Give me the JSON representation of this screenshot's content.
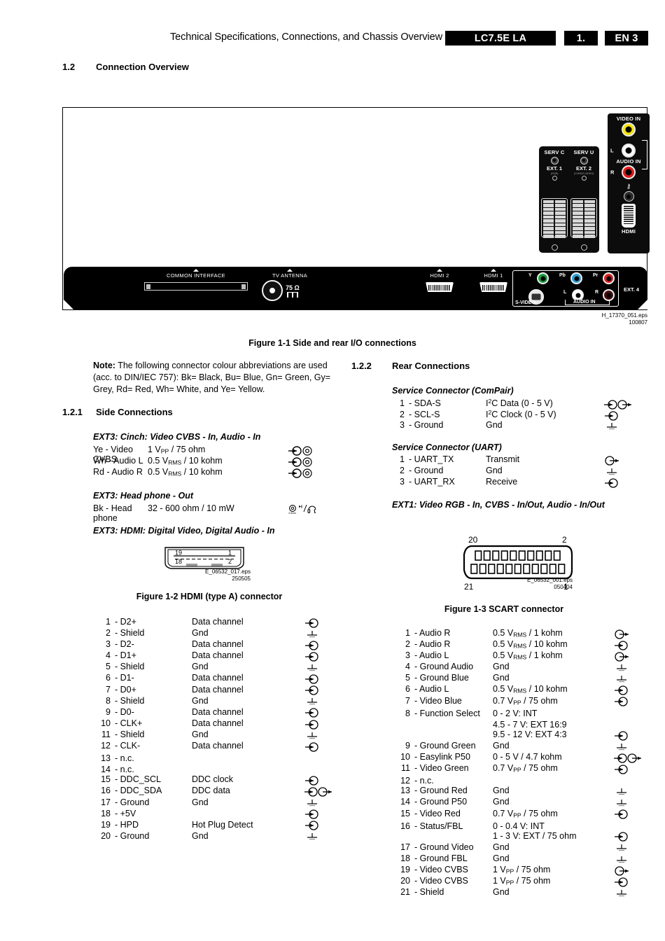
{
  "header": {
    "title": "Technical Specifications, Connections, and Chassis Overview",
    "chassis": "LC7.5E LA",
    "chapter": "1.",
    "page": "EN 3"
  },
  "section": {
    "number": "1.2",
    "title": "Connection Overview"
  },
  "figure1": {
    "caption": "Figure 1-1 Side and rear I/O connections",
    "eps": "H_17370_051.eps",
    "eps_date": "100807",
    "side_panel": {
      "serv_c": "SERV C",
      "serv_u": "SERV U",
      "ext1": "EXT. 1",
      "ext1_sub": "(RGB)",
      "ext2": "EXT. 2",
      "ext2_sub": "(CVBS/S-VIDEO)"
    },
    "right_strip": {
      "video_in": "VIDEO IN",
      "audio_in": "AUDIO IN",
      "left": "L",
      "right": "R",
      "hdmi": "HDMI"
    },
    "bottom": {
      "common_interface": "COMMON INTERFACE",
      "tv_antenna": "TV ANTENNA",
      "ohm": "75 Ω",
      "hdmi2": "HDMI 2",
      "hdmi1": "HDMI 1",
      "ext4": "EXT. 4",
      "y": "Y",
      "pb": "Pb",
      "pr": "Pr",
      "l": "L",
      "r": "R",
      "svideo": "S-VIDEO",
      "audio_in": "AUDIO IN"
    }
  },
  "note": {
    "label": "Note:",
    "text": " The following connector colour abbreviations are used (acc. to DIN/IEC 757): Bk= Black, Bu= Blue, Gn= Green, Gy= Grey, Rd= Red, Wh= White, and Ye= Yellow."
  },
  "side_connections": {
    "number": "1.2.1",
    "title": "Side Connections",
    "cinch": {
      "title": "EXT3: Cinch: Video CVBS - In, Audio - In",
      "rows": [
        {
          "name": "Ye  - Video CVBS",
          "desc": "1 V<sub>PP</sub> / 75 ohm",
          "sym": "in-cinch"
        },
        {
          "name": "Wh - Audio L",
          "desc": "0.5 V<sub>RMS</sub> / 10 kohm",
          "sym": "in-cinch"
        },
        {
          "name": "Rd  - Audio R",
          "desc": "0.5 V<sub>RMS</sub> / 10 kohm",
          "sym": "in-cinch"
        }
      ]
    },
    "headphone": {
      "title": "EXT3: Head phone - Out",
      "rows": [
        {
          "name": "Bk  - Head phone",
          "desc": "32 - 600 ohm / 10 mW",
          "sym": "headphone"
        }
      ]
    },
    "hdmi": {
      "title": "EXT3: HDMI: Digital Video, Digital Audio - In",
      "figure": {
        "caption": "Figure 1-2 HDMI (type A) connector",
        "pin_top_left": "19",
        "pin_top_right": "1",
        "pin_bot_left": "18",
        "pin_bot_right": "2",
        "eps": "E_06532_017.eps",
        "eps_date": "250505"
      },
      "rows": [
        {
          "pin": "1",
          "name": "- D2+",
          "desc": "Data channel",
          "sym": "in"
        },
        {
          "pin": "2",
          "name": "- Shield",
          "desc": "Gnd",
          "sym": "gnd"
        },
        {
          "pin": "3",
          "name": "- D2-",
          "desc": "Data channel",
          "sym": "in"
        },
        {
          "pin": "4",
          "name": "- D1+",
          "desc": "Data channel",
          "sym": "in"
        },
        {
          "pin": "5",
          "name": "- Shield",
          "desc": "Gnd",
          "sym": "gnd"
        },
        {
          "pin": "6",
          "name": "- D1-",
          "desc": "Data channel",
          "sym": "in"
        },
        {
          "pin": "7",
          "name": "- D0+",
          "desc": "Data channel",
          "sym": "in"
        },
        {
          "pin": "8",
          "name": "- Shield",
          "desc": "Gnd",
          "sym": "gnd"
        },
        {
          "pin": "9",
          "name": "- D0-",
          "desc": "Data channel",
          "sym": "in"
        },
        {
          "pin": "10",
          "name": "- CLK+",
          "desc": "Data channel",
          "sym": "in"
        },
        {
          "pin": "11",
          "name": "- Shield",
          "desc": "Gnd",
          "sym": "gnd"
        },
        {
          "pin": "12",
          "name": "- CLK-",
          "desc": "Data channel",
          "sym": "in"
        },
        {
          "pin": "13",
          "name": "- n.c.",
          "desc": "",
          "sym": ""
        },
        {
          "pin": "14",
          "name": "- n.c.",
          "desc": "",
          "sym": ""
        },
        {
          "pin": "15",
          "name": "- DDC_SCL",
          "desc": "DDC clock",
          "sym": "in"
        },
        {
          "pin": "16",
          "name": "- DDC_SDA",
          "desc": "DDC data",
          "sym": "inout"
        },
        {
          "pin": "17",
          "name": "- Ground",
          "desc": "Gnd",
          "sym": "gnd"
        },
        {
          "pin": "18",
          "name": "- +5V",
          "desc": "",
          "sym": "in"
        },
        {
          "pin": "19",
          "name": "- HPD",
          "desc": "Hot Plug Detect",
          "sym": "in"
        },
        {
          "pin": "20",
          "name": "- Ground",
          "desc": "Gnd",
          "sym": "gnd"
        }
      ]
    }
  },
  "rear_connections": {
    "number": "1.2.2",
    "title": "Rear Connections",
    "compair": {
      "title": "Service Connector (ComPair)",
      "rows": [
        {
          "pin": "1",
          "name": "- SDA-S",
          "desc": "I<sup>2</sup>C Data (0 - 5 V)",
          "sym": "inout"
        },
        {
          "pin": "2",
          "name": "- SCL-S",
          "desc": "I<sup>2</sup>C Clock (0 - 5 V)",
          "sym": "in"
        },
        {
          "pin": "3",
          "name": "- Ground",
          "desc": "Gnd",
          "sym": "gnd"
        }
      ]
    },
    "uart": {
      "title": "Service Connector (UART)",
      "rows": [
        {
          "pin": "1",
          "name": "- UART_TX",
          "desc": "Transmit",
          "sym": "out"
        },
        {
          "pin": "2",
          "name": "- Ground",
          "desc": "Gnd",
          "sym": "gnd"
        },
        {
          "pin": "3",
          "name": "- UART_RX",
          "desc": "Receive",
          "sym": "in"
        }
      ]
    },
    "scart": {
      "title": "EXT1: Video RGB - In, CVBS - In/Out, Audio - In/Out",
      "figure": {
        "caption": "Figure 1-3 SCART connector",
        "pin_top_left": "20",
        "pin_top_right": "2",
        "pin_bot_left": "21",
        "pin_bot_right": "1",
        "eps": "E_06532_001.eps",
        "eps_date": "050404"
      },
      "rows": [
        {
          "pin": "1",
          "name": "- Audio R",
          "desc": "0.5 V<sub>RMS</sub> / 1 kohm",
          "sym": "out"
        },
        {
          "pin": "2",
          "name": "- Audio R",
          "desc": "0.5 V<sub>RMS</sub> / 10 kohm",
          "sym": "in"
        },
        {
          "pin": "3",
          "name": "- Audio L",
          "desc": "0.5 V<sub>RMS</sub> / 1 kohm",
          "sym": "out"
        },
        {
          "pin": "4",
          "name": "- Ground Audio",
          "desc": "Gnd",
          "sym": "gnd"
        },
        {
          "pin": "5",
          "name": "- Ground Blue",
          "desc": "Gnd",
          "sym": "gnd"
        },
        {
          "pin": "6",
          "name": "- Audio L",
          "desc": "0.5 V<sub>RMS</sub> / 10 kohm",
          "sym": "in"
        },
        {
          "pin": "7",
          "name": "- Video Blue",
          "desc": "0.7 V<sub>PP</sub> / 75 ohm",
          "sym": "in"
        },
        {
          "pin": "8",
          "name": "- Function Select",
          "desc": "0 - 2 V: INT",
          "sym": ""
        },
        {
          "pin": "",
          "name": "",
          "desc": "4.5 - 7 V: EXT 16:9",
          "sym": ""
        },
        {
          "pin": "",
          "name": "",
          "desc": "9.5 - 12 V: EXT 4:3",
          "sym": "in"
        },
        {
          "pin": "9",
          "name": "- Ground Green",
          "desc": "Gnd",
          "sym": "gnd"
        },
        {
          "pin": "10",
          "name": "- Easylink P50",
          "desc": "0 - 5 V / 4.7 kohm",
          "sym": "inout"
        },
        {
          "pin": "11",
          "name": "- Video Green",
          "desc": "0.7 V<sub>PP</sub> / 75 ohm",
          "sym": "in"
        },
        {
          "pin": "12",
          "name": "- n.c.",
          "desc": "",
          "sym": ""
        },
        {
          "pin": "13",
          "name": "- Ground Red",
          "desc": "Gnd",
          "sym": "gnd"
        },
        {
          "pin": "14",
          "name": "- Ground P50",
          "desc": "Gnd",
          "sym": "gnd"
        },
        {
          "pin": "15",
          "name": "- Video Red",
          "desc": "0.7 V<sub>PP</sub> / 75 ohm",
          "sym": "in"
        },
        {
          "pin": "16",
          "name": "- Status/FBL",
          "desc": "0 - 0.4 V: INT",
          "sym": ""
        },
        {
          "pin": "",
          "name": "",
          "desc": "1 - 3 V: EXT / 75 ohm",
          "sym": "in"
        },
        {
          "pin": "17",
          "name": "- Ground Video",
          "desc": "Gnd",
          "sym": "gnd"
        },
        {
          "pin": "18",
          "name": "- Ground FBL",
          "desc": "Gnd",
          "sym": "gnd"
        },
        {
          "pin": "19",
          "name": "- Video CVBS",
          "desc": "1 V<sub>PP</sub> / 75 ohm",
          "sym": "out"
        },
        {
          "pin": "20",
          "name": "- Video CVBS",
          "desc": "1 V<sub>PP</sub> / 75 ohm",
          "sym": "in"
        },
        {
          "pin": "21",
          "name": "- Shield",
          "desc": "Gnd",
          "sym": "gnd"
        }
      ]
    }
  }
}
